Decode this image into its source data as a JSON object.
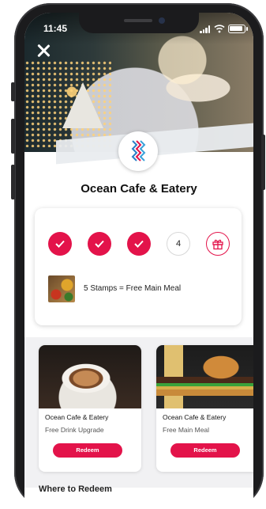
{
  "status_bar": {
    "time": "11:45"
  },
  "venue": {
    "name": "Ocean Cafe & Eatery"
  },
  "stamp_card": {
    "stamps_filled": 3,
    "stamps_total": 5,
    "next_stamp_label": "4",
    "reward_text": "5 Stamps = Free Main Meal",
    "accent_color": "#e3134a"
  },
  "offers": [
    {
      "venue": "Ocean Cafe & Eatery",
      "description": "Free Drink Upgrade",
      "button_label": "Redeem",
      "image": "coffee"
    },
    {
      "venue": "Ocean Cafe & Eatery",
      "description": "Free Main Meal",
      "button_label": "Redeem",
      "image": "burger"
    }
  ],
  "where_to_redeem": {
    "label": "Where to Redeem"
  }
}
